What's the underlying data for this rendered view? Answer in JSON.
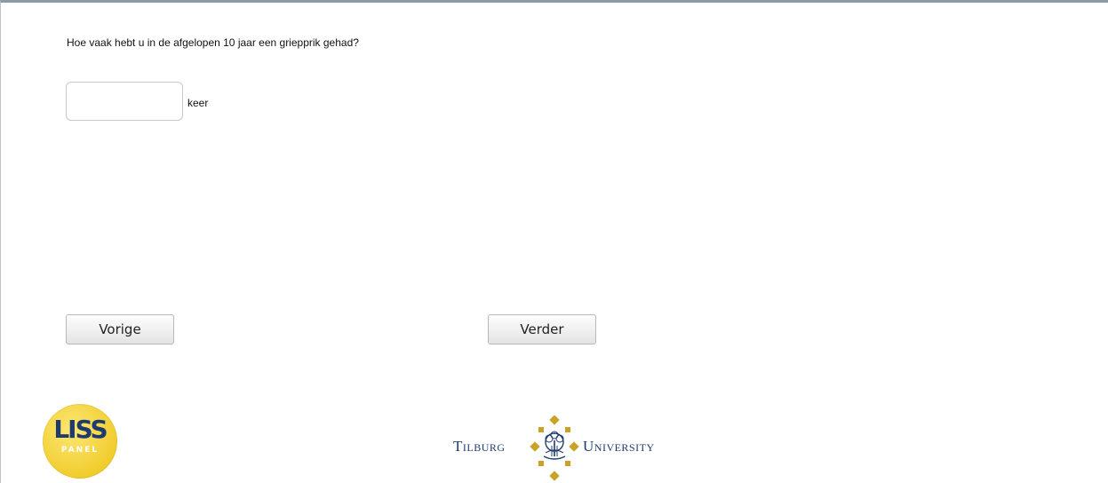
{
  "question": {
    "text": "Hoe vaak hebt u in de afgelopen 10 jaar een griepprik gehad?",
    "input_value": "",
    "unit": "keer"
  },
  "nav": {
    "prev_label": "Vorige",
    "next_label": "Verder"
  },
  "logos": {
    "liss_word": "LISS",
    "liss_panel": "PANEL",
    "tilburg_left": "Tilburg",
    "tilburg_right": "University"
  },
  "colors": {
    "brand_navy": "#1f3b6e",
    "brand_gold": "#c9a227",
    "liss_yellow": "#f1cd2e"
  }
}
